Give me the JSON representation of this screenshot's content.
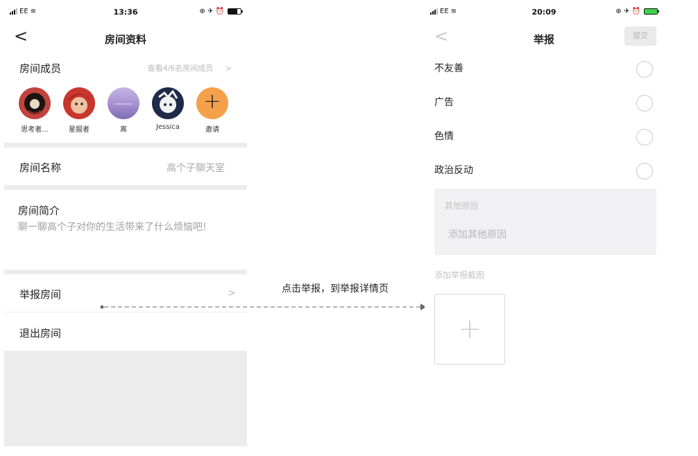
{
  "left": {
    "status": {
      "carrier": "EE",
      "time": "13:36",
      "icons": "⊕ ✈ ⏰"
    },
    "nav": {
      "back": "<",
      "title": "房间资料"
    },
    "members": {
      "label": "房间成员",
      "more": "查看4/6名房间成员",
      "chevron": ">",
      "people": [
        {
          "name": "思考者...",
          "color": "#2a1e1a"
        },
        {
          "name": "星掘者",
          "color": "#c8372d"
        },
        {
          "name": "离",
          "color": "#a99ed4"
        },
        {
          "name": "Jessica",
          "color": "#1f2a48"
        }
      ],
      "invite": {
        "label": "邀请",
        "icon": "+",
        "color": "#f5a04a"
      }
    },
    "room_name": {
      "label": "房间名称",
      "value": "高个子聊天室"
    },
    "room_intro": {
      "label": "房间简介",
      "text": "聊一聊高个子对你的生活带来了什么烦恼吧!"
    },
    "report": {
      "label": "举报房间",
      "chevron": ">"
    },
    "leave": {
      "label": "退出房间"
    }
  },
  "annotation": {
    "text": "点击举报，到举报详情页"
  },
  "right": {
    "status": {
      "carrier": "EE",
      "time": "20:09",
      "icons": "⊕ ✈ ⏰"
    },
    "nav": {
      "back": "<",
      "title": "举报",
      "submit": "提交"
    },
    "options": [
      {
        "label": "不友善"
      },
      {
        "label": "广告"
      },
      {
        "label": "色情"
      },
      {
        "label": "政治反动"
      }
    ],
    "other": {
      "label": "其他原因",
      "placeholder": "添加其他原因"
    },
    "screenshot": {
      "label": "添加举报截图",
      "icon": "+"
    }
  }
}
